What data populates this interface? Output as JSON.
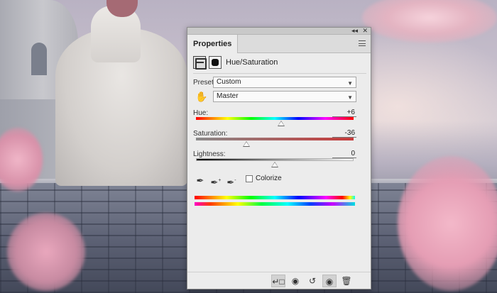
{
  "panel": {
    "tab_label": "Properties",
    "collapse_glyph": "◂◂",
    "close_glyph": "✕",
    "adjustment_title": "Hue/Saturation",
    "preset": {
      "label": "Preset:",
      "value": "Custom"
    },
    "channel": {
      "value": "Master"
    },
    "hue": {
      "label": "Hue:",
      "value": "+6",
      "position": 0.54
    },
    "saturation": {
      "label": "Saturation:",
      "value": "-36",
      "position": 0.32
    },
    "lightness": {
      "label": "Lightness:",
      "value": "0",
      "position": 0.5
    },
    "colorize": {
      "label": "Colorize",
      "checked": false
    },
    "icons": {
      "panel_menu": "menu-icon",
      "adjustment_layer": "adjustment-layer-icon",
      "mask": "mask-icon",
      "targeted_adjustment": "hand-icon",
      "eyedroppers": [
        "eyedropper-icon",
        "eyedropper-plus-icon",
        "eyedropper-minus-icon"
      ],
      "bottom": [
        "clip-to-layer-icon",
        "view-previous-icon",
        "reset-icon",
        "visibility-eye-icon",
        "trash-icon"
      ]
    }
  }
}
